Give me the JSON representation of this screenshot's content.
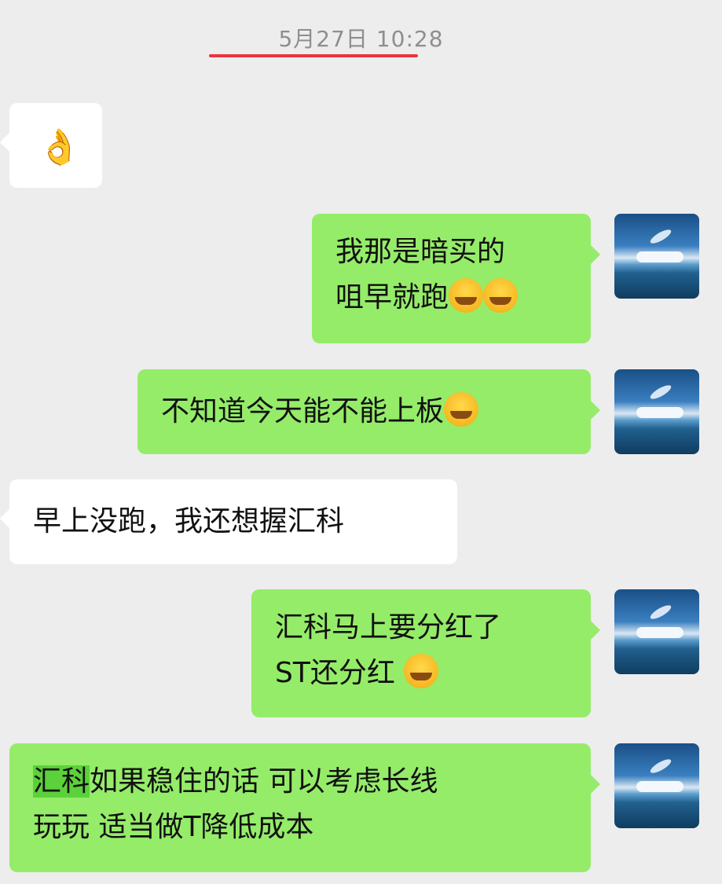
{
  "chat": {
    "timestamp": "5月27日 10:28",
    "messages": [
      {
        "side": "in",
        "emoji_ok": "👌"
      },
      {
        "side": "out",
        "line1": "我那是暗买的",
        "line2": "咀早就跑"
      },
      {
        "side": "out",
        "text": "不知道今天能不能上板"
      },
      {
        "side": "in",
        "text": "早上没跑，我还想握汇科"
      },
      {
        "side": "out",
        "line1": "汇科马上要分红了",
        "line2": "ST还分红"
      },
      {
        "side": "out",
        "highlight": "汇科",
        "line1_rest": "如果稳住的话 可以考虑长线",
        "line2": "玩玩  适当做T降低成本"
      }
    ]
  },
  "colors": {
    "background": "#ededed",
    "outgoing_bubble": "#95ec69",
    "incoming_bubble": "#ffffff",
    "timestamp_underline": "#e8343f"
  },
  "icons": {
    "emoji_face": "laughing-crying-emoji-icon",
    "ok_hand": "ok-hand-icon",
    "avatar": "sea-dolphin-avatar"
  }
}
